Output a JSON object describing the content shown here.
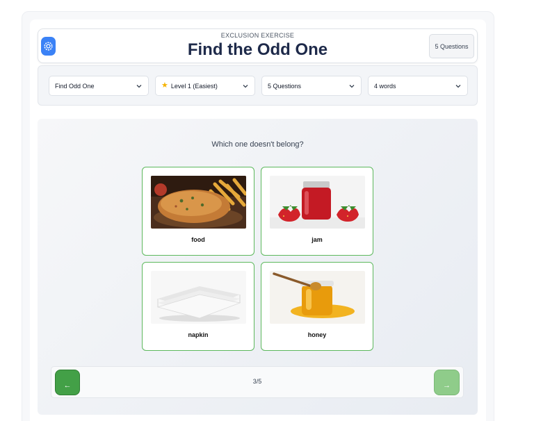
{
  "header": {
    "subtitle": "EXCLUSION EXERCISE",
    "title": "Find the Odd One",
    "badge": "5 Questions"
  },
  "controls": {
    "mode": "Find Odd One",
    "level": "Level 1 (Easiest)",
    "questions": "5 Questions",
    "words": "4 words"
  },
  "main": {
    "prompt": "Which one doesn't belong?",
    "options": [
      {
        "word": "food",
        "image": "fried-cutlet-with-fries"
      },
      {
        "word": "jam",
        "image": "jar-of-strawberry-jam"
      },
      {
        "word": "napkin",
        "image": "stack-of-white-napkins"
      },
      {
        "word": "honey",
        "image": "honey-jar-with-dipper"
      }
    ]
  },
  "nav": {
    "prev_label": "←",
    "next_label": "→",
    "progress": "3/5"
  },
  "colors": {
    "accent_blue": "#3b82f6",
    "title": "#1e2a4a",
    "card_border": "#5cb85c",
    "prev_button": "#43a047",
    "next_button": "#8fcc8a"
  }
}
